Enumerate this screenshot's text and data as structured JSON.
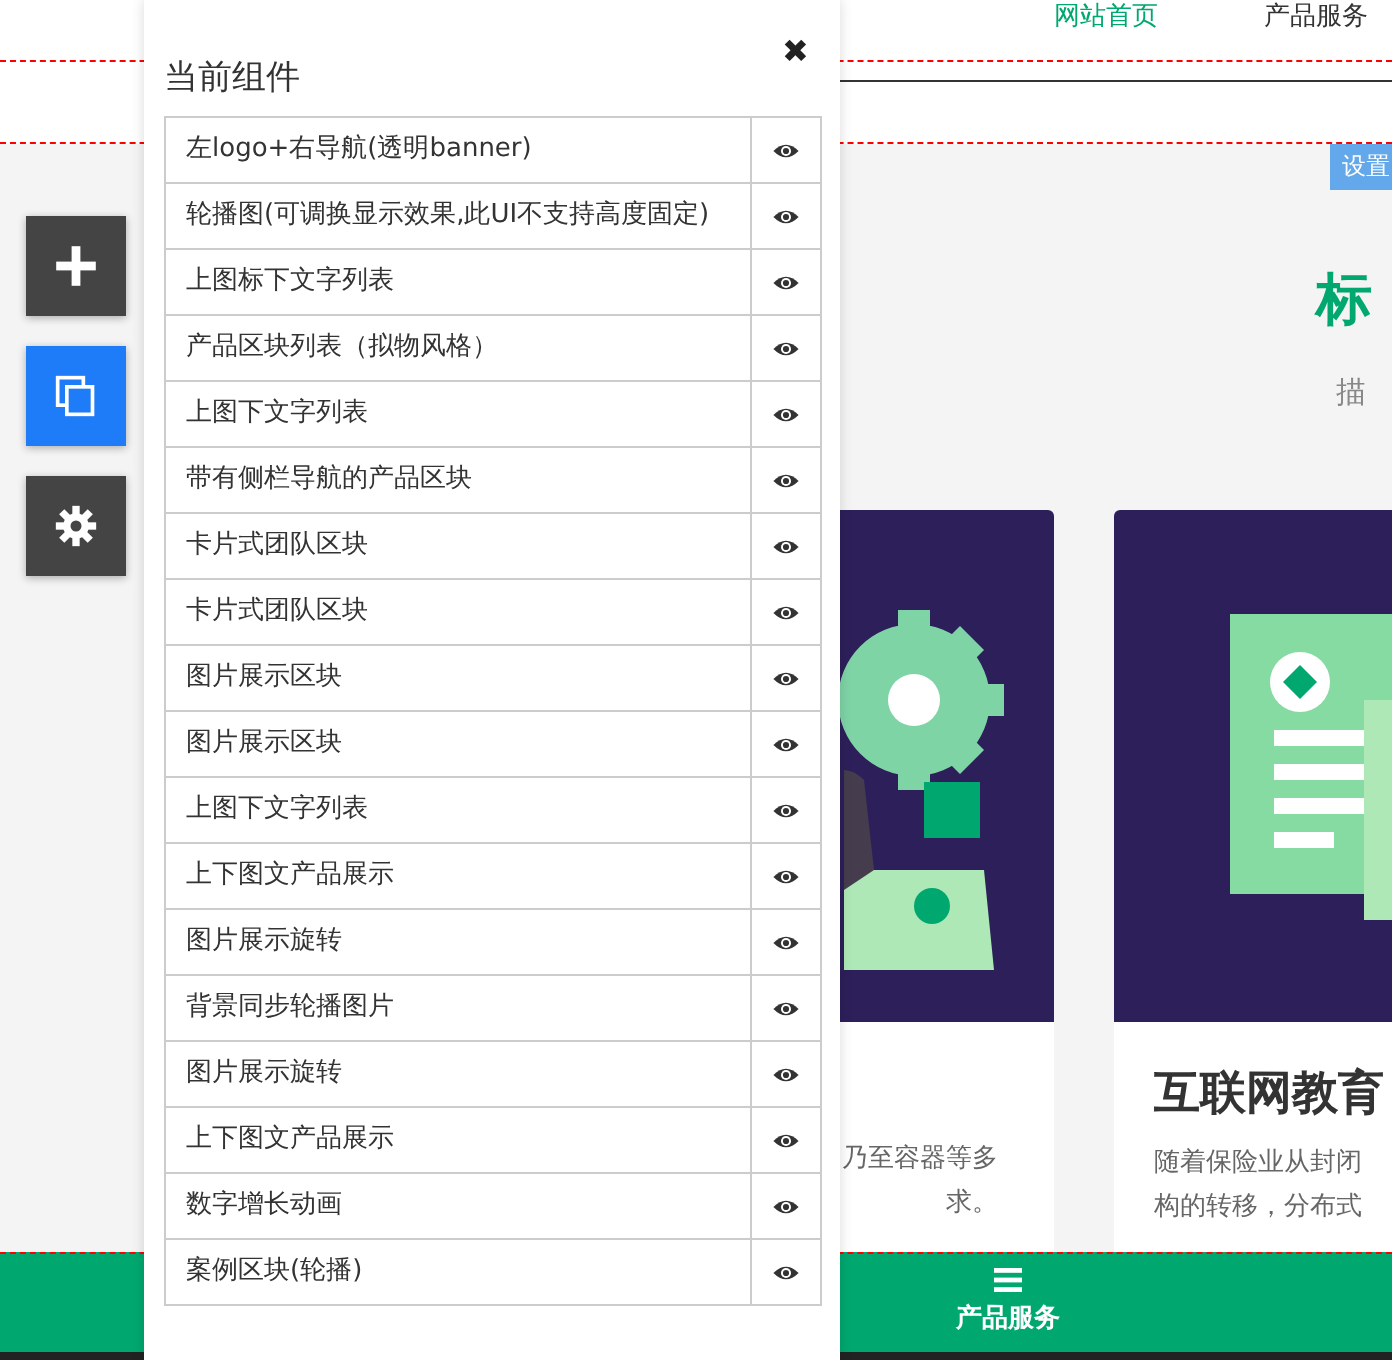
{
  "header": {
    "nav": [
      {
        "label": "网站首页",
        "selected": true
      },
      {
        "label": "产品服务",
        "selected": false
      }
    ]
  },
  "tool_buttons": [
    {
      "kind": "add",
      "selected": false
    },
    {
      "kind": "copy",
      "selected": true
    },
    {
      "kind": "settings",
      "selected": false
    }
  ],
  "settings_badge": "设置",
  "section": {
    "title": "标",
    "description": "描"
  },
  "cards": [
    {
      "kind": "gear",
      "description": [
        "乃至容器等多",
        "求。"
      ]
    },
    {
      "kind": "document",
      "title": "互联网教育",
      "description": [
        "随着保险业从封闭",
        "构的转移，分布式"
      ]
    }
  ],
  "panel": {
    "title": "当前组件",
    "close": "✖",
    "components": [
      "左logo+右导航(透明banner)",
      "轮播图(可调换显示效果,此UI不支持高度固定)",
      "上图标下文字列表",
      "产品区块列表（拟物风格）",
      "上图下文字列表",
      "带有侧栏导航的产品区块",
      "卡片式团队区块",
      "卡片式团队区块",
      "图片展示区块",
      "图片展示区块",
      "上图下文字列表",
      "上下图文产品展示",
      "图片展示旋转",
      "背景同步轮播图片",
      "图片展示旋转",
      "上下图文产品展示",
      "数字增长动画",
      "案例区块(轮播)"
    ]
  },
  "bottom_bar": {
    "label": "产品服务"
  }
}
